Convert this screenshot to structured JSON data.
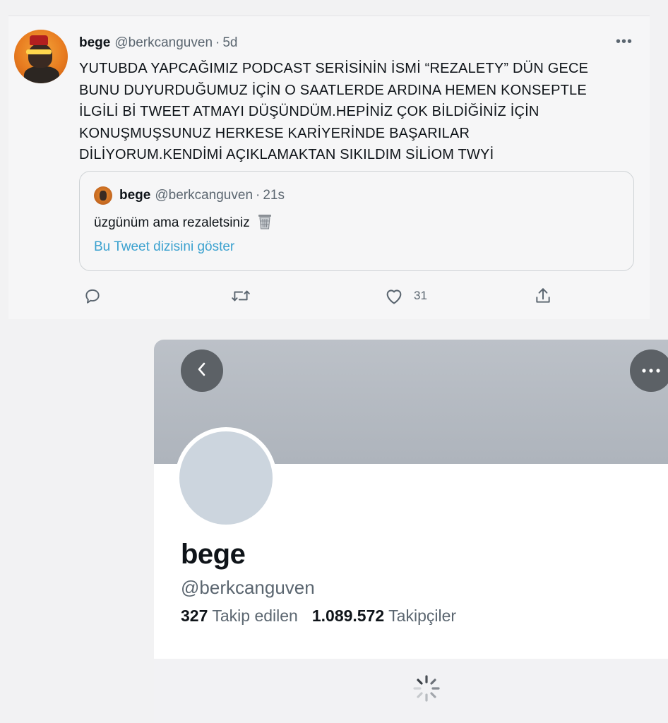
{
  "tweet": {
    "name": "bege",
    "handle": "@berkcanguven",
    "separator": "·",
    "time": "5d",
    "more": "•••",
    "lines": [
      "YUTUBDA YAPCAĞIMIZ PODCAST SERİSİNİN İSMİ “REZALETY” DÜN GECE",
      "BUNU DUYURDUĞUMUZ İÇİN O SAATLERDE ARDINA HEMEN KONSEPTLE",
      "İLGİLİ Bİ TWEET ATMAYI DÜŞÜNDÜM.HEPİNİZ ÇOK BİLDİĞİNİZ İÇİN",
      "KONUŞMUŞSUNUZ  HERKESE KARİYERİNDE BAŞARILAR",
      "DİLİYORUM.KENDİMİ AÇIKLAMAKTAN SIKILDIM SİLİOM TWYİ"
    ],
    "quote": {
      "name": "bege",
      "handle": "@berkcanguven",
      "separator": "·",
      "time": "21s",
      "text": "üzgünüm ama rezaletsiniz",
      "link": "Bu Tweet dizisini göster"
    },
    "actions": {
      "reply_icon": "reply-icon",
      "retweet_icon": "retweet-icon",
      "like_icon": "heart-icon",
      "like_count": "31",
      "share_icon": "share-icon"
    }
  },
  "profile": {
    "name": "bege",
    "handle": "@berkcanguven",
    "following_count": "327",
    "following_label": "Takip edilen",
    "followers_count": "1.089.572",
    "followers_label": "Takipçiler"
  },
  "colors": {
    "link": "#3aa1cf",
    "muted": "#5b6670",
    "banner": "#b4bac1",
    "avatar_placeholder": "#ccd5de"
  }
}
